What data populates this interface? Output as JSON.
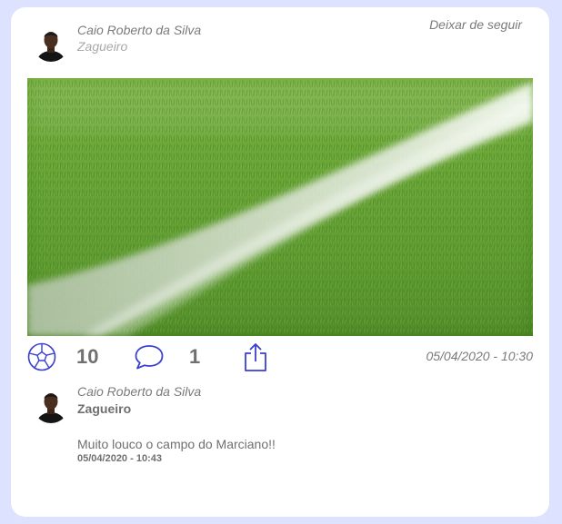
{
  "post": {
    "author": "Caio Roberto da Silva",
    "role": "Zagueiro",
    "unfollow_label": "Deixar de seguir",
    "image_icon": "football-field-grass-photo",
    "likes": "10",
    "comments": "1",
    "date": "05/04/2020 - 10:30"
  },
  "icons": {
    "like": "soccer-ball-icon",
    "comment": "speech-bubble-icon",
    "share": "share-icon"
  },
  "comment": {
    "author": "Caio Roberto da Silva",
    "role": "Zagueiro",
    "text": "Muito louco o campo do Marciano!!",
    "date": "05/04/2020 - 10:43"
  },
  "colors": {
    "page_background": "#dde3ff",
    "card_background": "#ffffff",
    "accent_blue": "#3b3fcf"
  }
}
